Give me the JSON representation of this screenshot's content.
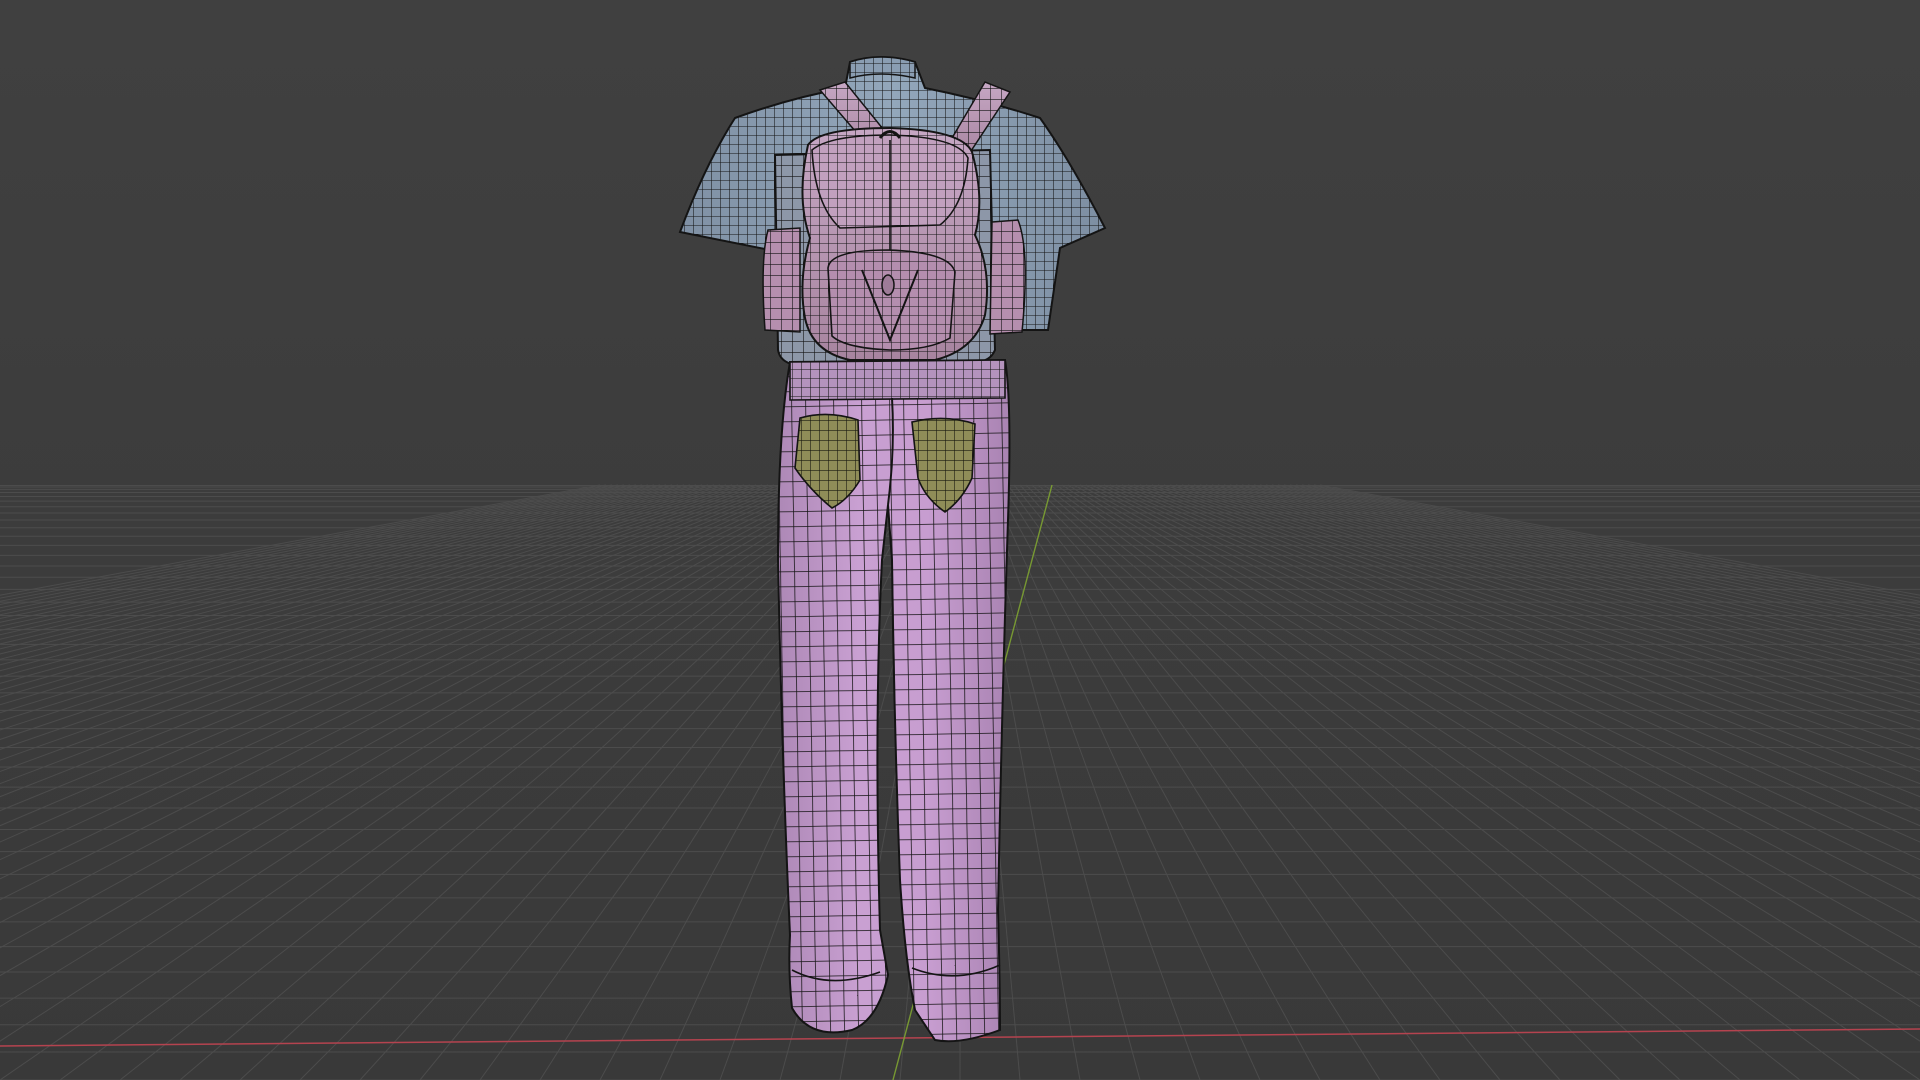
{
  "viewport": {
    "kind": "3d-viewport",
    "background_top": "#3f3f3f",
    "background_bottom": "#3a3a3a",
    "grid_color": "#4c4c4c",
    "x_axis_color": "#b5434f",
    "y_axis_color": "#7ea332",
    "wireframe_color": "#141414"
  },
  "model": {
    "view": "back",
    "display": "solid-with-wireframe",
    "parts": [
      {
        "name": "shirt",
        "color": "#8fa3b7"
      },
      {
        "name": "backpack",
        "color": "#c7a3bf"
      },
      {
        "name": "pants",
        "color": "#c79cd0"
      },
      {
        "name": "back-pockets",
        "color": "#8f8d58"
      }
    ]
  }
}
